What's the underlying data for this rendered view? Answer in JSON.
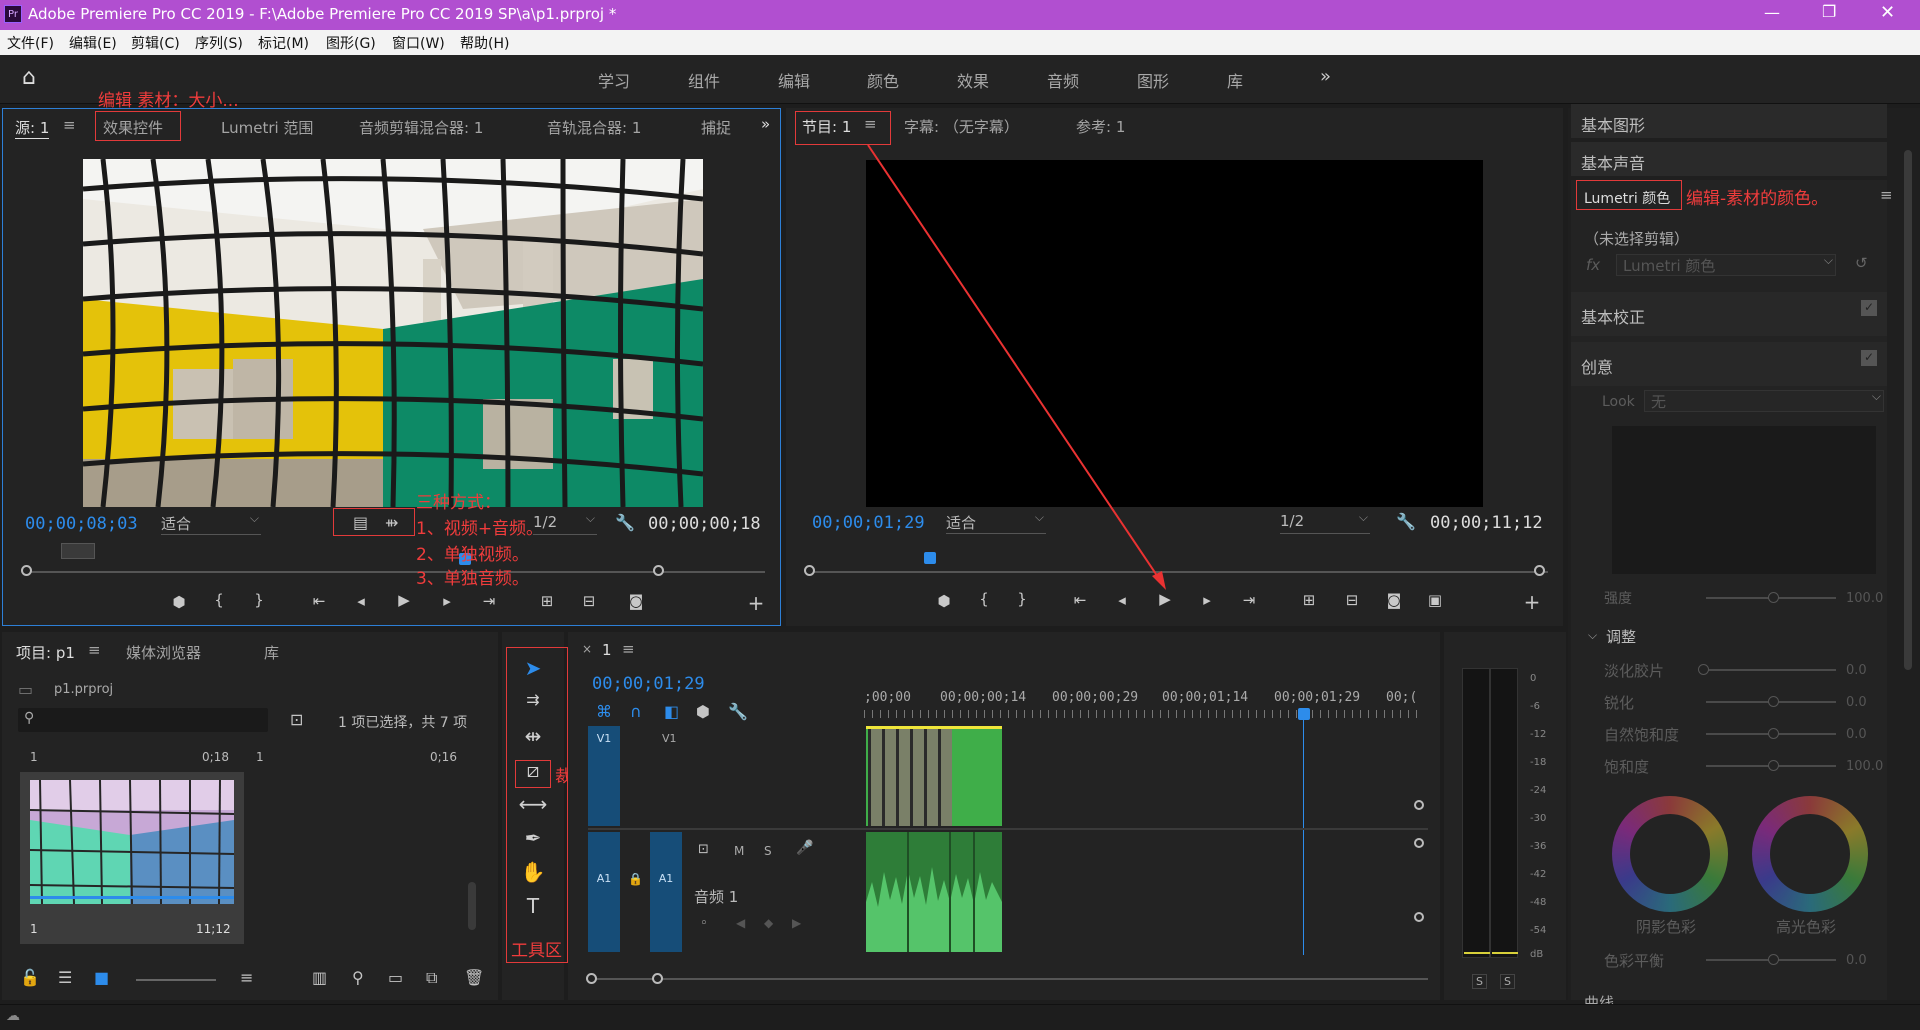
{
  "titlebar": {
    "title": "Adobe Premiere Pro CC 2019 - F:\\Adobe Premiere Pro CC 2019 SP\\a\\p1.prproj *",
    "icon": "Pr"
  },
  "menu": [
    "文件(F)",
    "编辑(E)",
    "剪辑(C)",
    "序列(S)",
    "标记(M)",
    "图形(G)",
    "窗口(W)",
    "帮助(H)"
  ],
  "workspaces": [
    "学习",
    "组件",
    "编辑",
    "颜色",
    "效果",
    "音频",
    "图形",
    "库"
  ],
  "source_panel": {
    "tabs": [
      "源: 1",
      "效果控件",
      "Lumetri 范围",
      "音频剪辑混合器: 1",
      "音轨混合器: 1",
      "捕捉"
    ],
    "timecode": "00;00;08;03",
    "fit": "适合",
    "resolution": "1/2",
    "duration": "00;00;00;18"
  },
  "program_panel": {
    "tabs": [
      "节目: 1",
      "字幕: （无字幕）",
      "参考: 1"
    ],
    "timecode": "00;00;01;29",
    "fit": "适合",
    "resolution": "1/2",
    "duration": "00;00;11;12"
  },
  "project_panel": {
    "tabs": [
      "项目: p1",
      "媒体浏览器",
      "库"
    ],
    "file": "p1.prproj",
    "selection_info": "1 项已选择，共 7 项",
    "item1": {
      "top_label": "1",
      "top_time": "0;18",
      "bottom_label": "1",
      "bottom_time": "11;12"
    },
    "item2": {
      "top_label": "1",
      "top_time": "0;16"
    }
  },
  "timeline": {
    "tab": "1",
    "timecode": "00;00;01;29",
    "ruler": [
      ";00;00",
      "00;00;00;14",
      "00;00;00;29",
      "00;00;01;14",
      "00;00;01;29",
      "00;("
    ],
    "video_track": {
      "src": "V1",
      "name": "V1"
    },
    "audio_track": {
      "src": "A1",
      "name": "A1",
      "title": "音频 1",
      "m": "M",
      "s": "S"
    }
  },
  "meter_scale": [
    "0",
    "-6",
    "-12",
    "-18",
    "-24",
    "-30",
    "-36",
    "-42",
    "-48",
    "-54",
    "dB"
  ],
  "meter_solo": [
    "S",
    "S"
  ],
  "right_panel": {
    "rows": [
      "基本图形",
      "基本声音"
    ],
    "lumetri_tab": "Lumetri 颜色",
    "no_clip": "（未选择剪辑）",
    "fx_label": "fx",
    "fx_value": "Lumetri 颜色",
    "basic_correction": "基本校正",
    "creative": "创意",
    "look_label": "Look",
    "look_value": "无",
    "intensity": {
      "label": "强度",
      "value": "100.0"
    },
    "adjust": "调整",
    "sliders": [
      {
        "label": "淡化胶片",
        "value": "0.0"
      },
      {
        "label": "锐化",
        "value": "0.0"
      },
      {
        "label": "自然饱和度",
        "value": "0.0"
      },
      {
        "label": "饱和度",
        "value": "100.0"
      }
    ],
    "wheel_labels": [
      "阴影色彩",
      "高光色彩"
    ],
    "balance": {
      "label": "色彩平衡",
      "value": "0.0"
    },
    "curves": "曲线"
  },
  "annotations": {
    "effect_controls": "编辑 素材：大小...",
    "three_ways_title": "三种方式：",
    "three_ways_1": "1、视频+音频。",
    "three_ways_2": "2、单独视频。",
    "three_ways_3": "3、单独音频。",
    "lumetri": "编辑-素材的颜色。",
    "razor": "裁剪视频",
    "tools": "工具区"
  },
  "colors": {
    "accent_blue": "#2d8ceb",
    "title_purple": "#b14fd0",
    "annotation_red": "#e23a3a",
    "clip_green": "#3fae49"
  }
}
